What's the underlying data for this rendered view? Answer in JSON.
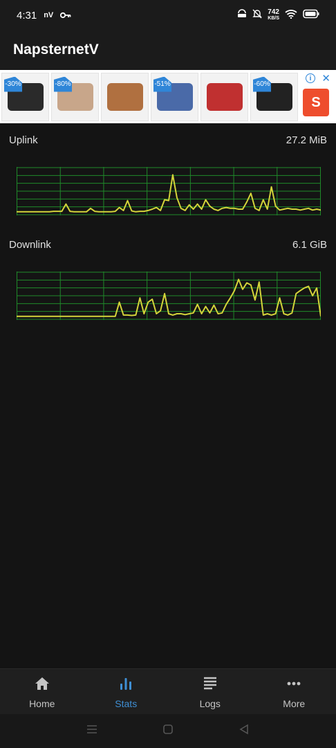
{
  "status_bar": {
    "time": "4:31",
    "carrier_badge": "nV",
    "speed_value": "742",
    "speed_unit": "KB/S",
    "icons": [
      "key-icon",
      "vpn-icon",
      "bell-off-icon",
      "wifi-icon",
      "battery-icon"
    ]
  },
  "app": {
    "title": "NapsternetV"
  },
  "ad": {
    "items": [
      {
        "badge": "-30%",
        "color": "#2a2a2a"
      },
      {
        "badge": "-80%",
        "color": "#c8a68a"
      },
      {
        "badge": "",
        "color": "#b07040"
      },
      {
        "badge": "-51%",
        "color": "#4a6aa8"
      },
      {
        "badge": "",
        "color": "#c03030"
      },
      {
        "badge": "-60%",
        "color": "#222222"
      }
    ],
    "info_icon": "info-icon",
    "close_icon": "close-icon",
    "shop_letter": "S"
  },
  "uplink": {
    "label": "Uplink",
    "value": "27.2 MiB"
  },
  "downlink": {
    "label": "Downlink",
    "value": "6.1 GiB"
  },
  "graph_style": {
    "line_color": "#d4d43a",
    "grid_color": "#1f8a2a",
    "background": "#141414"
  },
  "chart_data": [
    {
      "type": "line",
      "name": "uplink",
      "y_range": [
        0,
        1
      ],
      "values": [
        0.02,
        0.02,
        0.02,
        0.02,
        0.02,
        0.02,
        0.02,
        0.02,
        0.02,
        0.03,
        0.03,
        0.03,
        0.2,
        0.03,
        0.02,
        0.02,
        0.02,
        0.02,
        0.1,
        0.03,
        0.02,
        0.02,
        0.02,
        0.02,
        0.03,
        0.12,
        0.05,
        0.28,
        0.04,
        0.02,
        0.03,
        0.03,
        0.05,
        0.08,
        0.12,
        0.05,
        0.3,
        0.28,
        0.88,
        0.35,
        0.1,
        0.05,
        0.18,
        0.08,
        0.2,
        0.08,
        0.3,
        0.15,
        0.08,
        0.05,
        0.1,
        0.12,
        0.1,
        0.1,
        0.08,
        0.08,
        0.25,
        0.45,
        0.1,
        0.05,
        0.3,
        0.08,
        0.6,
        0.15,
        0.06,
        0.08,
        0.1,
        0.08,
        0.08,
        0.06,
        0.08,
        0.1,
        0.06,
        0.08,
        0.06
      ]
    },
    {
      "type": "line",
      "name": "downlink",
      "y_range": [
        0,
        1
      ],
      "values": [
        0.02,
        0.02,
        0.02,
        0.02,
        0.02,
        0.02,
        0.02,
        0.02,
        0.02,
        0.02,
        0.02,
        0.02,
        0.02,
        0.02,
        0.02,
        0.02,
        0.02,
        0.02,
        0.02,
        0.02,
        0.02,
        0.02,
        0.02,
        0.02,
        0.02,
        0.35,
        0.05,
        0.05,
        0.04,
        0.05,
        0.45,
        0.08,
        0.35,
        0.42,
        0.08,
        0.15,
        0.55,
        0.08,
        0.05,
        0.08,
        0.08,
        0.06,
        0.08,
        0.1,
        0.3,
        0.08,
        0.25,
        0.1,
        0.28,
        0.08,
        0.1,
        0.3,
        0.45,
        0.62,
        0.88,
        0.65,
        0.8,
        0.75,
        0.4,
        0.82,
        0.05,
        0.08,
        0.05,
        0.08,
        0.45,
        0.08,
        0.05,
        0.1,
        0.55,
        0.62,
        0.68,
        0.72,
        0.5,
        0.68,
        0.02
      ]
    }
  ],
  "bottom_nav": [
    {
      "label": "Home",
      "icon": "home-icon",
      "active": false
    },
    {
      "label": "Stats",
      "icon": "stats-icon",
      "active": true
    },
    {
      "label": "Logs",
      "icon": "logs-icon",
      "active": false
    },
    {
      "label": "More",
      "icon": "more-icon",
      "active": false
    }
  ],
  "system_nav": [
    "menu-icon",
    "home-square-icon",
    "back-icon"
  ]
}
